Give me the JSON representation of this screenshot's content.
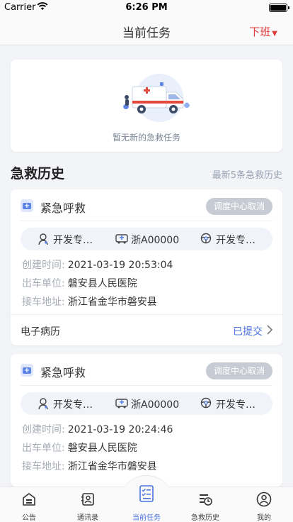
{
  "status_bar": {
    "carrier": "Carrier",
    "time": "6:26 PM"
  },
  "nav": {
    "title": "当前任务",
    "off_duty": "下班",
    "caret": "▼"
  },
  "empty_state": {
    "text": "暂无新的急救任务"
  },
  "history": {
    "title": "急救历史",
    "subtitle": "最新5条急救历史",
    "records": [
      {
        "type": "紧急呼救",
        "cancel_status": "调度中心取消",
        "doctor": "开发专…",
        "vehicle": "浙A00000",
        "driver": "开发专…",
        "created_label": "创建时间:",
        "created_time": "2021-03-19 20:53:04",
        "unit_label": "出车单位:",
        "unit": "磐安县人民医院",
        "address_label": "接车地址:",
        "address": "浙江省金华市磐安县",
        "emr_label": "电子病历",
        "emr_status": "已提交"
      },
      {
        "type": "紧急呼救",
        "cancel_status": "调度中心取消",
        "doctor": "开发专…",
        "vehicle": "浙A00000",
        "driver": "开发专…",
        "created_label": "创建时间:",
        "created_time": "2021-03-19 20:24:46",
        "unit_label": "出车单位:",
        "unit": "磐安县人民医院",
        "address_label": "接车地址:",
        "address": "浙江省金华市磐安县"
      }
    ]
  },
  "tabs": [
    {
      "label": "公告",
      "icon": "announcement-icon"
    },
    {
      "label": "通讯录",
      "icon": "contacts-icon"
    },
    {
      "label": "当前任务",
      "icon": "current-task-icon",
      "active": true
    },
    {
      "label": "急救历史",
      "icon": "history-icon"
    },
    {
      "label": "我的",
      "icon": "profile-icon"
    }
  ],
  "colors": {
    "accent": "#4b74e0",
    "danger": "#e23b3b",
    "badge": "#c7cbd3",
    "muted": "#a6acb6"
  }
}
